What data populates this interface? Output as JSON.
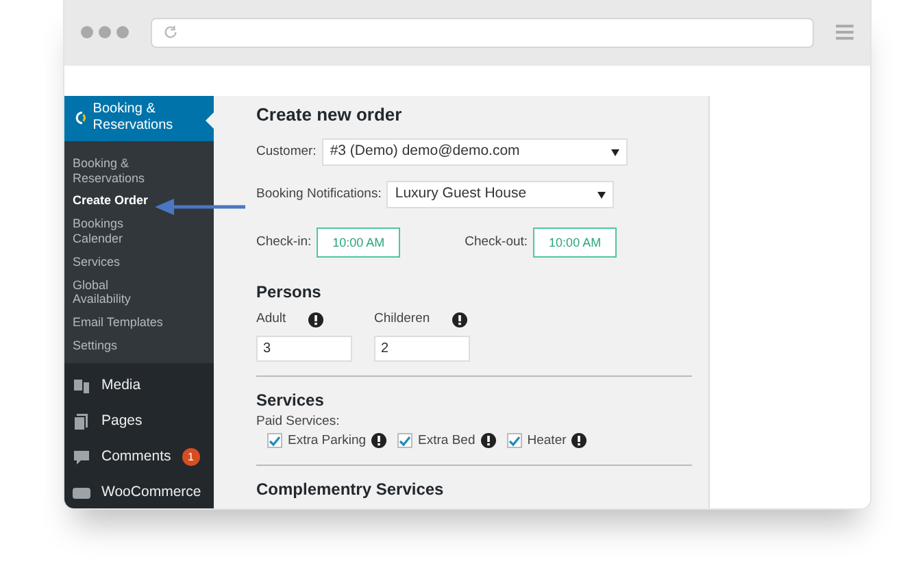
{
  "sidebar": {
    "plugin": {
      "label": "Booking & Reservations",
      "selected": true
    },
    "submenu": [
      {
        "label": "Booking & Reservations",
        "selected": false
      },
      {
        "label": "Create Order",
        "selected": true
      },
      {
        "label": "Bookings Calender",
        "selected": false
      },
      {
        "label": "Services",
        "selected": false
      },
      {
        "label": "Global Availability",
        "selected": false
      },
      {
        "label": "Email Templates",
        "selected": false
      },
      {
        "label": "Settings",
        "selected": false
      }
    ],
    "menu": [
      {
        "label": "Media",
        "kind": "media"
      },
      {
        "label": "Pages",
        "kind": "pages"
      },
      {
        "label": "Comments",
        "kind": "comments",
        "badge": "1"
      },
      {
        "label": "WooCommerce",
        "kind": "woo"
      }
    ]
  },
  "form": {
    "title": "Create new order",
    "customer": {
      "label": "Customer:",
      "value": "#3 (Demo) demo@demo.com"
    },
    "notifications": {
      "label": "Booking Notifications:",
      "value": "Luxury Guest House"
    },
    "check_in": {
      "label": "Check-in:",
      "value": "10:00 AM"
    },
    "check_out": {
      "label": "Check-out:",
      "value": "10:00 AM"
    },
    "persons": {
      "heading": "Persons",
      "fields": [
        {
          "label": "Adult",
          "value": "3"
        },
        {
          "label": "Childeren",
          "value": "2"
        }
      ]
    },
    "services": {
      "heading": "Services",
      "label": "Paid Services:",
      "items": [
        {
          "label": "Extra Parking",
          "checked": true
        },
        {
          "label": "Extra Bed",
          "checked": true
        },
        {
          "label": "Heater",
          "checked": true
        }
      ]
    },
    "complementary": {
      "heading": "Complementry Services"
    }
  }
}
